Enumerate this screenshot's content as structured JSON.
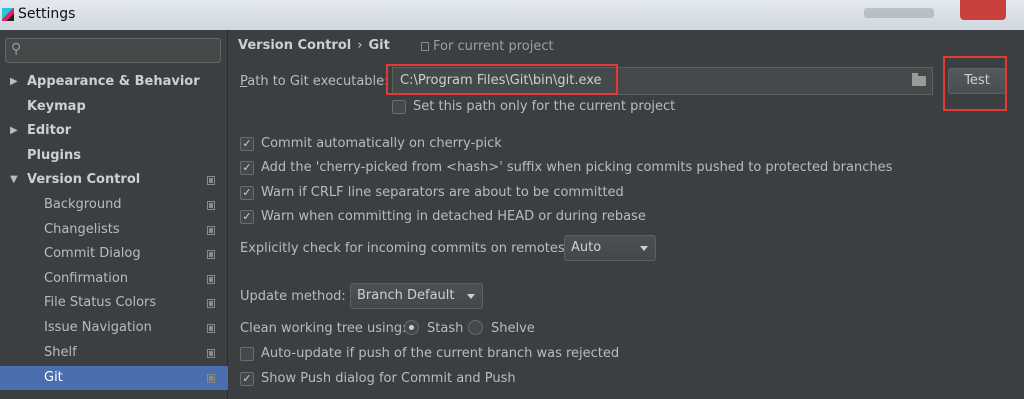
{
  "window": {
    "title": "Settings"
  },
  "sidebar": {
    "search_placeholder": "",
    "items": [
      {
        "label": "Appearance & Behavior"
      },
      {
        "label": "Keymap"
      },
      {
        "label": "Editor"
      },
      {
        "label": "Plugins"
      },
      {
        "label": "Version Control"
      },
      {
        "label": "Background"
      },
      {
        "label": "Changelists"
      },
      {
        "label": "Commit Dialog"
      },
      {
        "label": "Confirmation"
      },
      {
        "label": "File Status Colors"
      },
      {
        "label": "Issue Navigation"
      },
      {
        "label": "Shelf"
      },
      {
        "label": "Git"
      }
    ]
  },
  "main": {
    "breadcrumb": {
      "parent": "Version Control",
      "separator": "›",
      "current": "Git"
    },
    "scope": "For current project",
    "path_label_first": "P",
    "path_label_rest": "ath to Git executable:",
    "path_value": "C:\\Program Files\\Git\\bin\\git.exe",
    "test_button": "Test",
    "set_path_only": "Set this path only for the current project",
    "checkboxes": [
      {
        "label": "Commit automatically on cherry-pick",
        "checked": true
      },
      {
        "label": "Add the 'cherry-picked from <hash>' suffix when picking commits pushed to protected branches",
        "checked": true
      },
      {
        "label": "Warn if CRLF line separators are about to be committed",
        "checked": true
      },
      {
        "label": "Warn when committing in detached HEAD or during rebase",
        "checked": true
      }
    ],
    "incoming_label": "Explicitly check for incoming commits on remotes:",
    "incoming_value": "Auto",
    "update_method_label": "Update method:",
    "update_method_value": "Branch Default",
    "clean_tree_label": "Clean working tree using:",
    "clean_options": {
      "stash": "Stash",
      "shelve": "Shelve",
      "selected": "Stash"
    },
    "auto_update": {
      "label": "Auto-update if push of the current branch was rejected",
      "checked": false
    },
    "show_push": {
      "label": "Show Push dialog for Commit and Push",
      "checked": true
    }
  },
  "colors": {
    "selection": "#4b6eaf",
    "highlight": "#e53935",
    "background": "#3c3f41"
  }
}
